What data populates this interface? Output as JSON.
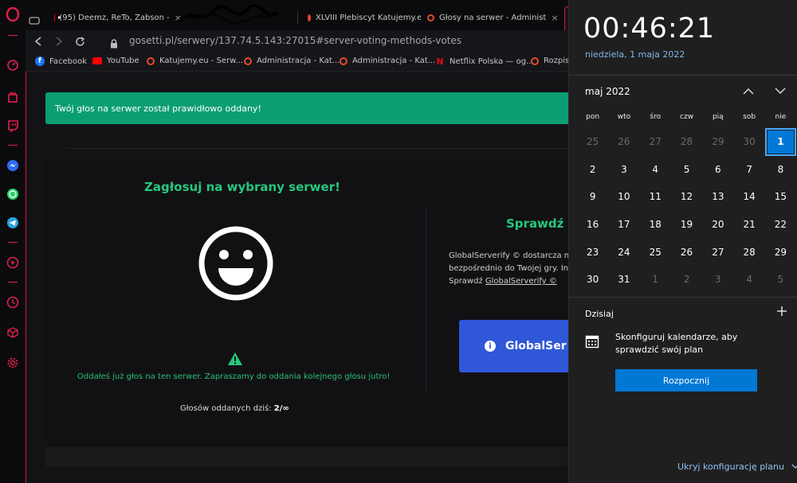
{
  "browser": {
    "tabs": [
      {
        "label": "(95) Deemz, ReTo, Zabson -",
        "icon": "youtube-icon"
      },
      {
        "label": "XLVIII Plebiscyt Katujemy.e",
        "icon": "katujemy-icon"
      },
      {
        "label": "Głosy na serwer - Administ",
        "icon": "katujemy-icon"
      }
    ],
    "url": "gosetti.pl/serwery/137.74.5.143:27015#server-voting-methods-votes",
    "bookmarks": [
      {
        "label": "Facebook",
        "icon": "facebook-icon"
      },
      {
        "label": "YouTube",
        "icon": "youtube-icon"
      },
      {
        "label": "Katujemy.eu - Serw...",
        "icon": "katujemy-icon"
      },
      {
        "label": "Administracja - Kat...",
        "icon": "katujemy-icon"
      },
      {
        "label": "Administracja - Kat...",
        "icon": "katujemy-icon"
      },
      {
        "label": "Netflix Polska — og...",
        "icon": "netflix-icon"
      },
      {
        "label": "Rozpis",
        "icon": "katujemy-icon"
      }
    ]
  },
  "page": {
    "alert": "Twój głos na serwer został prawidłowo oddany!",
    "vote_title": "Zagłosuj na wybrany serwer!",
    "already_voted": "Oddałeś już głos na ten serwer. Zapraszamy do oddania kolejnego głosu jutro!",
    "votes_label": "Głosów oddanych dziś:",
    "votes_value": "2/∞",
    "check_title": "Sprawdź i",
    "gs_desc": [
      "GlobalServerify © dostarcza n",
      "bezpośrednio do Twojej gry. In",
      "Sprawdź"
    ],
    "gs_link": "GlobalServerify ©",
    "gs_button": "GlobalSer"
  },
  "flyout": {
    "time": "00:46:21",
    "date": "niedziela, 1 maja 2022",
    "month": "maj 2022",
    "weekdays": [
      "pon",
      "wto",
      "śro",
      "czw",
      "pią",
      "sob",
      "nie"
    ],
    "weeks": [
      [
        "25",
        "26",
        "27",
        "28",
        "29",
        "30",
        "1"
      ],
      [
        "2",
        "3",
        "4",
        "5",
        "6",
        "7",
        "8"
      ],
      [
        "9",
        "10",
        "11",
        "12",
        "13",
        "14",
        "15"
      ],
      [
        "16",
        "17",
        "18",
        "19",
        "20",
        "21",
        "22"
      ],
      [
        "23",
        "24",
        "25",
        "26",
        "27",
        "28",
        "29"
      ],
      [
        "30",
        "31",
        "1",
        "2",
        "3",
        "4",
        "5"
      ]
    ],
    "today_label": "Dzisiaj",
    "configure_text": "Skonfiguruj kalendarze, aby sprawdzić swój plan",
    "start_button": "Rozpocznij",
    "hide_link": "Ukryj konfigurację planu"
  }
}
